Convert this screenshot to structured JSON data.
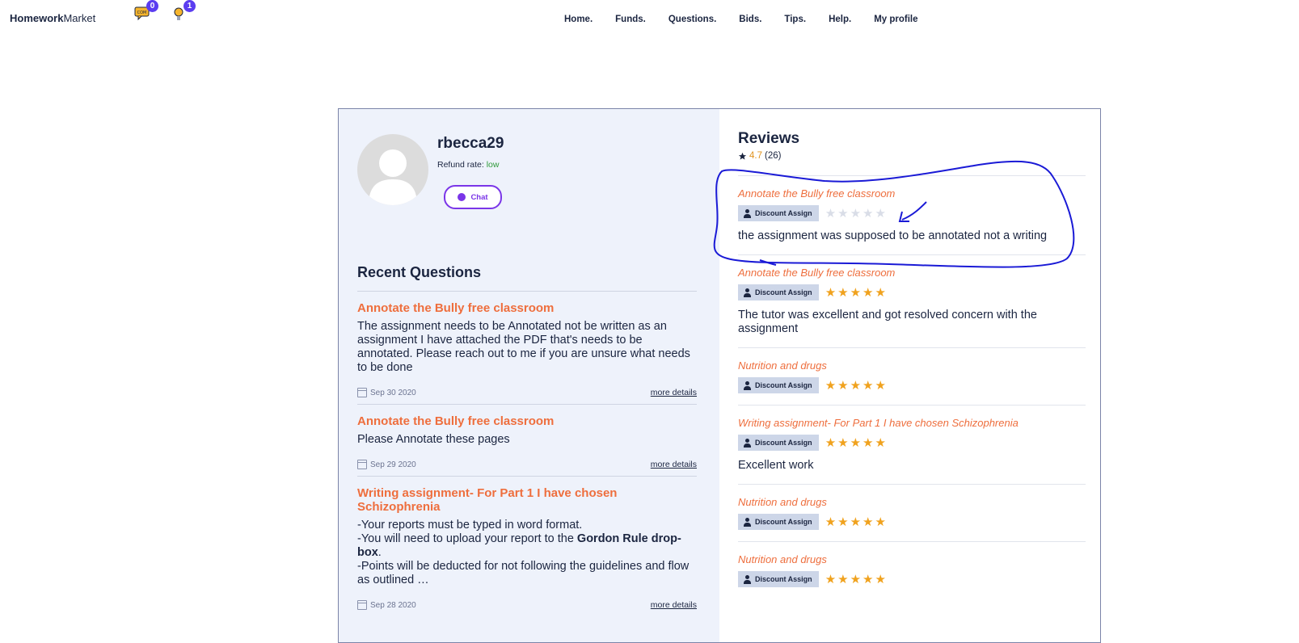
{
  "header": {
    "brand_bold": "Homework",
    "brand_rest": "Market",
    "messages_badge": "0",
    "ideas_badge": "1",
    "nav": [
      "Home.",
      "Funds.",
      "Questions.",
      "Bids.",
      "Tips.",
      "Help.",
      "My profile"
    ]
  },
  "profile": {
    "username": "rbecca29",
    "refund_label": "Refund rate:",
    "refund_value": "low",
    "chat_label": "Chat"
  },
  "recent_questions": {
    "heading": "Recent Questions",
    "items": [
      {
        "title": "Annotate the Bully free classroom",
        "body": "The assignment needs to be Annotated not be written as an assignment I have attached the PDF that's needs to be annotated. Please reach out to me if you are unsure what needs to be done",
        "date": "Sep 30 2020",
        "more": "more details"
      },
      {
        "title": "Annotate the Bully free classroom",
        "body": "Please Annotate these pages",
        "date": "Sep 29 2020",
        "more": "more details"
      },
      {
        "title": "Writing assignment- For Part 1 I have chosen Schizophrenia",
        "body_lines": [
          "-Your reports must be typed in word format.",
          "-You will need to upload your report to the ",
          "Gordon Rule drop-box",
          ".",
          "-Points will be deducted for not following the guidelines and flow as outlined …"
        ],
        "date": "Sep 28 2020",
        "more": "more details"
      }
    ]
  },
  "reviews": {
    "heading": "Reviews",
    "rating": "4.7",
    "count": "(26)",
    "items": [
      {
        "title": "Annotate the Bully free classroom",
        "tag": "Discount Assign",
        "stars": 0,
        "text": "the assignment was supposed to be annotated not a writing"
      },
      {
        "title": "Annotate the Bully free classroom",
        "tag": "Discount Assign",
        "stars": 5,
        "text": "The tutor was excellent and got resolved concern with the assignment"
      },
      {
        "title": "Nutrition and drugs",
        "tag": "Discount Assign",
        "stars": 5,
        "text": ""
      },
      {
        "title": "Writing assignment- For Part 1 I have chosen Schizophrenia",
        "tag": "Discount Assign",
        "stars": 5,
        "text": "Excellent work"
      },
      {
        "title": "Nutrition and drugs",
        "tag": "Discount Assign",
        "stars": 5,
        "text": ""
      },
      {
        "title": "Nutrition and drugs",
        "tag": "Discount Assign",
        "stars": 5,
        "text": ""
      }
    ]
  },
  "colors": {
    "accent_orange": "#ee6e3d",
    "star": "#f0a21e",
    "chat_purple": "#7a35e8",
    "annotation_blue": "#1a1ad6"
  }
}
